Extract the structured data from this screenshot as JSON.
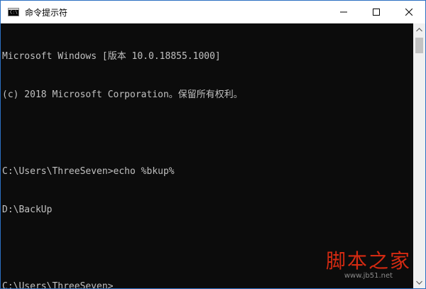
{
  "window": {
    "title": "命令提示符",
    "icon_label": "C:\\",
    "controls": {
      "minimize_icon": "minimize-icon",
      "maximize_icon": "maximize-icon",
      "close_icon": "close-icon"
    }
  },
  "console": {
    "lines": [
      "Microsoft Windows [版本 10.0.18855.1000]",
      "(c) 2018 Microsoft Corporation。保留所有权利。",
      "",
      "C:\\Users\\ThreeSeven>echo %bkup%",
      "D:\\BackUp",
      "",
      "C:\\Users\\ThreeSeven>"
    ]
  },
  "scrollbar": {
    "up_icon": "scroll-up-arrow-icon",
    "down_icon": "scroll-down-arrow-icon"
  },
  "watermark": {
    "brand": "脚本之家",
    "url": "www.jb51.net"
  },
  "colors": {
    "console_bg": "#0c0c0c",
    "console_text": "#c0c0c0",
    "titlebar_bg": "#ffffff",
    "watermark": "#d42a12"
  }
}
